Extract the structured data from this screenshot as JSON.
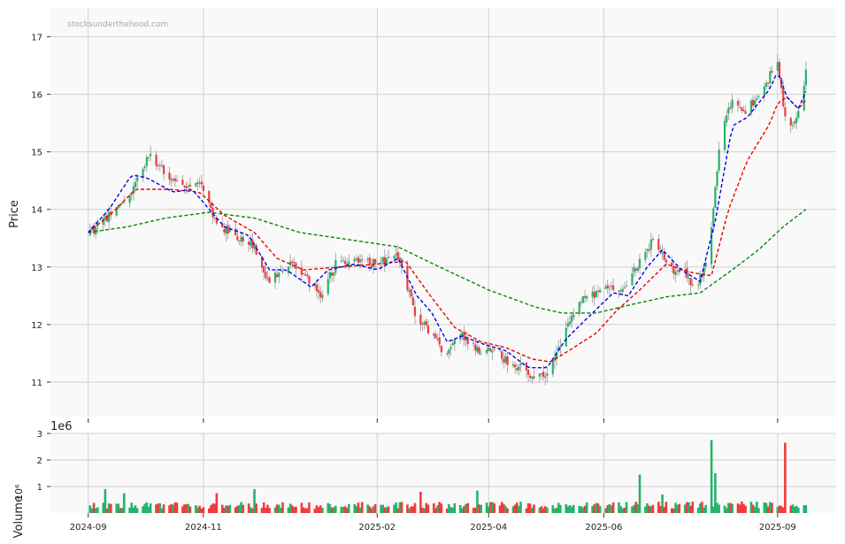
{
  "watermark": "stocksunderthehood.com",
  "colors": {
    "up": "#26b36b",
    "down": "#f23b3b",
    "ma_fast": "#0000ee",
    "ma_mid": "#ee0000",
    "ma_slow": "#008800",
    "panel_bg": "#f9f9f9",
    "grid": "#d0d0d0"
  },
  "chart_data": [
    {
      "type": "candlestick",
      "ylabel": "Price",
      "ylim": [
        10.4,
        17.5
      ],
      "yticks": [
        11,
        12,
        13,
        14,
        15,
        16,
        17
      ],
      "x_dates": [
        "2024-09",
        "2024-11",
        "2025-02",
        "2025-04",
        "2025-06",
        "2025-09"
      ],
      "grid": true,
      "anchors": [
        [
          "2024-09-01",
          13.55
        ],
        [
          "2024-09-12",
          13.9
        ],
        [
          "2024-09-22",
          14.2
        ],
        [
          "2024-10-03",
          14.95
        ],
        [
          "2024-10-10",
          14.7
        ],
        [
          "2024-10-22",
          14.35
        ],
        [
          "2024-10-31",
          14.45
        ],
        [
          "2024-11-08",
          13.75
        ],
        [
          "2024-11-18",
          13.55
        ],
        [
          "2024-11-28",
          13.35
        ],
        [
          "2024-12-05",
          12.75
        ],
        [
          "2024-12-15",
          13.05
        ],
        [
          "2024-12-22",
          12.95
        ],
        [
          "2025-01-02",
          12.5
        ],
        [
          "2025-01-10",
          13.05
        ],
        [
          "2025-01-20",
          13.1
        ],
        [
          "2025-02-01",
          13.05
        ],
        [
          "2025-02-12",
          13.2
        ],
        [
          "2025-02-22",
          12.1
        ],
        [
          "2025-03-02",
          11.85
        ],
        [
          "2025-03-10",
          11.45
        ],
        [
          "2025-03-17",
          11.85
        ],
        [
          "2025-03-26",
          11.55
        ],
        [
          "2025-04-04",
          11.6
        ],
        [
          "2025-04-12",
          11.3
        ],
        [
          "2025-04-19",
          11.25
        ],
        [
          "2025-04-26",
          11.05
        ],
        [
          "2025-05-03",
          11.2
        ],
        [
          "2025-05-12",
          11.9
        ],
        [
          "2025-05-20",
          12.4
        ],
        [
          "2025-05-28",
          12.55
        ],
        [
          "2025-06-05",
          12.6
        ],
        [
          "2025-06-12",
          12.65
        ],
        [
          "2025-06-20",
          13.1
        ],
        [
          "2025-06-28",
          13.5
        ],
        [
          "2025-07-06",
          12.95
        ],
        [
          "2025-07-13",
          12.95
        ],
        [
          "2025-07-20",
          12.6
        ],
        [
          "2025-07-27",
          13.3
        ],
        [
          "2025-08-02",
          15.4
        ],
        [
          "2025-08-08",
          15.9
        ],
        [
          "2025-08-15",
          15.7
        ],
        [
          "2025-08-22",
          16.0
        ],
        [
          "2025-09-01",
          16.55
        ],
        [
          "2025-09-06",
          15.3
        ],
        [
          "2025-09-12",
          15.7
        ],
        [
          "2025-09-16",
          16.35
        ]
      ],
      "ma_fast": [
        [
          "2024-09-01",
          13.6
        ],
        [
          "2024-09-12",
          14.0
        ],
        [
          "2024-09-24",
          14.6
        ],
        [
          "2024-10-02",
          14.55
        ],
        [
          "2024-10-16",
          14.3
        ],
        [
          "2024-10-26",
          14.35
        ],
        [
          "2024-11-12",
          13.7
        ],
        [
          "2024-11-25",
          13.55
        ],
        [
          "2024-12-06",
          12.95
        ],
        [
          "2024-12-15",
          12.95
        ],
        [
          "2024-12-28",
          12.65
        ],
        [
          "2025-01-06",
          12.95
        ],
        [
          "2025-01-20",
          13.05
        ],
        [
          "2025-02-01",
          12.95
        ],
        [
          "2025-02-12",
          13.15
        ],
        [
          "2025-02-22",
          12.5
        ],
        [
          "2025-03-02",
          12.2
        ],
        [
          "2025-03-10",
          11.7
        ],
        [
          "2025-03-18",
          11.8
        ],
        [
          "2025-03-30",
          11.65
        ],
        [
          "2025-04-10",
          11.55
        ],
        [
          "2025-04-22",
          11.25
        ],
        [
          "2025-05-02",
          11.25
        ],
        [
          "2025-05-12",
          11.75
        ],
        [
          "2025-05-26",
          12.2
        ],
        [
          "2025-06-06",
          12.55
        ],
        [
          "2025-06-14",
          12.5
        ],
        [
          "2025-06-24",
          13.0
        ],
        [
          "2025-07-02",
          13.3
        ],
        [
          "2025-07-12",
          12.95
        ],
        [
          "2025-07-22",
          12.75
        ],
        [
          "2025-07-30",
          13.8
        ],
        [
          "2025-08-08",
          15.45
        ],
        [
          "2025-08-16",
          15.6
        ],
        [
          "2025-08-28",
          16.1
        ],
        [
          "2025-09-01",
          16.4
        ],
        [
          "2025-09-06",
          15.95
        ],
        [
          "2025-09-12",
          15.75
        ],
        [
          "2025-09-16",
          16.05
        ]
      ],
      "ma_mid": [
        [
          "2024-09-01",
          13.6
        ],
        [
          "2024-09-14",
          13.95
        ],
        [
          "2024-09-26",
          14.35
        ],
        [
          "2024-10-14",
          14.35
        ],
        [
          "2024-10-30",
          14.3
        ],
        [
          "2024-11-12",
          13.9
        ],
        [
          "2024-11-28",
          13.6
        ],
        [
          "2024-12-10",
          13.15
        ],
        [
          "2024-12-24",
          12.95
        ],
        [
          "2025-01-12",
          13.0
        ],
        [
          "2025-02-01",
          13.05
        ],
        [
          "2025-02-16",
          13.1
        ],
        [
          "2025-02-28",
          12.55
        ],
        [
          "2025-03-14",
          11.95
        ],
        [
          "2025-03-28",
          11.7
        ],
        [
          "2025-04-10",
          11.6
        ],
        [
          "2025-04-24",
          11.4
        ],
        [
          "2025-05-04",
          11.35
        ],
        [
          "2025-05-16",
          11.6
        ],
        [
          "2025-05-28",
          11.85
        ],
        [
          "2025-06-08",
          12.25
        ],
        [
          "2025-06-20",
          12.6
        ],
        [
          "2025-07-04",
          13.05
        ],
        [
          "2025-07-18",
          12.9
        ],
        [
          "2025-07-28",
          12.85
        ],
        [
          "2025-08-06",
          14.0
        ],
        [
          "2025-08-16",
          14.85
        ],
        [
          "2025-08-28",
          15.5
        ],
        [
          "2025-09-01",
          15.85
        ],
        [
          "2025-09-06",
          15.95
        ],
        [
          "2025-09-12",
          15.75
        ],
        [
          "2025-09-16",
          15.9
        ]
      ],
      "ma_slow": [
        [
          "2024-09-01",
          13.6
        ],
        [
          "2024-09-22",
          13.7
        ],
        [
          "2024-10-12",
          13.85
        ],
        [
          "2024-11-04",
          13.95
        ],
        [
          "2024-11-28",
          13.85
        ],
        [
          "2024-12-22",
          13.6
        ],
        [
          "2025-01-22",
          13.45
        ],
        [
          "2025-02-12",
          13.35
        ],
        [
          "2025-03-06",
          13.0
        ],
        [
          "2025-04-01",
          12.6
        ],
        [
          "2025-04-26",
          12.3
        ],
        [
          "2025-05-10",
          12.2
        ],
        [
          "2025-05-28",
          12.2
        ],
        [
          "2025-06-16",
          12.35
        ],
        [
          "2025-07-04",
          12.48
        ],
        [
          "2025-07-22",
          12.55
        ],
        [
          "2025-08-08",
          12.95
        ],
        [
          "2025-08-22",
          13.3
        ],
        [
          "2025-09-04",
          13.7
        ],
        [
          "2025-09-16",
          14.0
        ]
      ]
    },
    {
      "type": "bar",
      "ylabel": "Volume",
      "ylabel_multiplier": "10⁶",
      "offset_label": "1e6",
      "ylim": [
        0,
        3
      ],
      "yticks": [
        1,
        2,
        3
      ],
      "base_millions": 0.3,
      "spikes": [
        [
          "2024-09-10",
          0.9
        ],
        [
          "2024-09-20",
          0.75
        ],
        [
          "2024-11-08",
          0.75
        ],
        [
          "2024-11-28",
          0.9
        ],
        [
          "2025-02-16",
          0.6
        ],
        [
          "2025-02-24",
          0.8
        ],
        [
          "2025-03-02",
          1.05
        ],
        [
          "2025-03-26",
          0.85
        ],
        [
          "2025-04-12",
          0.75
        ],
        [
          "2025-06-20",
          1.45
        ],
        [
          "2025-07-02",
          0.7
        ],
        [
          "2025-07-28",
          2.75
        ],
        [
          "2025-07-30",
          1.5
        ],
        [
          "2025-08-10",
          0.85
        ],
        [
          "2025-09-05",
          2.65
        ]
      ]
    }
  ]
}
